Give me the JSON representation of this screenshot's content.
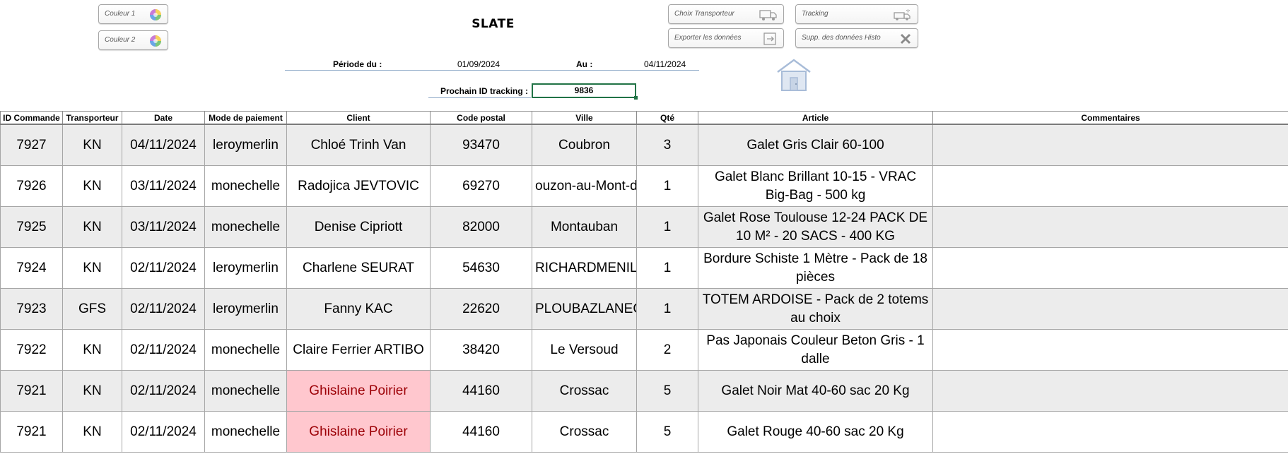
{
  "app": {
    "title": "SLATE"
  },
  "colors": {
    "header_border": "#8c8c8c",
    "alt_row": "#ececec",
    "duplicate_fill": "#ffc7ce",
    "duplicate_text": "#9c0006",
    "selection": "#217346"
  },
  "buttons": {
    "couleur1": "Couleur 1",
    "couleur2": "Couleur 2",
    "choix_transporteur": "Choix Transporteur",
    "tracking": "Tracking",
    "exporter": "Exporter les données",
    "supp_histo": "Supp. des données Histo"
  },
  "period": {
    "from_label": "Période du :",
    "from_value": "01/09/2024",
    "to_label": "Au :",
    "to_value": "04/11/2024"
  },
  "tracking": {
    "label": "Prochain ID tracking :",
    "value": "9836"
  },
  "table": {
    "headers": [
      "ID Commande",
      "Transporteur",
      "Date",
      "Mode de paiement",
      "Client",
      "Code postal",
      "Ville",
      "Qté",
      "Article",
      "Commentaires"
    ],
    "rows": [
      {
        "id": "7927",
        "transporteur": "KN",
        "date": "04/11/2024",
        "paiement": "leroymerlin",
        "client": "Chloé Trinh Van",
        "cp": "93470",
        "ville": "Coubron",
        "qte": "3",
        "article": "Galet Gris Clair 60-100",
        "commentaires": ""
      },
      {
        "id": "7926",
        "transporteur": "KN",
        "date": "03/11/2024",
        "paiement": "monechelle",
        "client": "Radojica JEVTOVIC",
        "cp": "69270",
        "ville": "ouzon-au-Mont-d'",
        "qte": "1",
        "article": "Galet Blanc Brillant 10-15 - VRAC Big-Bag - 500 kg",
        "commentaires": ""
      },
      {
        "id": "7925",
        "transporteur": "KN",
        "date": "03/11/2024",
        "paiement": "monechelle",
        "client": "Denise Cipriott",
        "cp": "82000",
        "ville": "Montauban",
        "qte": "1",
        "article": "Galet Rose Toulouse 12-24 PACK DE 10 M² - 20 SACS - 400 KG",
        "commentaires": ""
      },
      {
        "id": "7924",
        "transporteur": "KN",
        "date": "02/11/2024",
        "paiement": "leroymerlin",
        "client": "Charlene SEURAT",
        "cp": "54630",
        "ville": "RICHARDMENIL",
        "qte": "1",
        "article": "Bordure Schiste 1 Mètre - Pack de 18 pièces",
        "commentaires": ""
      },
      {
        "id": "7923",
        "transporteur": "GFS",
        "date": "02/11/2024",
        "paiement": "leroymerlin",
        "client": "Fanny KAC",
        "cp": "22620",
        "ville": "PLOUBAZLANEC",
        "qte": "1",
        "article": "TOTEM ARDOISE - Pack de 2 totems au choix",
        "commentaires": ""
      },
      {
        "id": "7922",
        "transporteur": "KN",
        "date": "02/11/2024",
        "paiement": "monechelle",
        "client": "Claire Ferrier ARTIBO",
        "cp": "38420",
        "ville": "Le Versoud",
        "qte": "2",
        "article": "Pas Japonais Couleur Beton Gris - 1 dalle",
        "commentaires": ""
      },
      {
        "id": "7921",
        "transporteur": "KN",
        "date": "02/11/2024",
        "paiement": "monechelle",
        "client": "Ghislaine Poirier",
        "cp": "44160",
        "ville": "Crossac",
        "qte": "5",
        "article": "Galet Noir Mat 40-60 sac 20 Kg",
        "commentaires": ""
      },
      {
        "id": "7921",
        "transporteur": "KN",
        "date": "02/11/2024",
        "paiement": "monechelle",
        "client": "Ghislaine Poirier",
        "cp": "44160",
        "ville": "Crossac",
        "qte": "5",
        "article": "Galet Rouge 40-60 sac 20 Kg",
        "commentaires": ""
      }
    ]
  }
}
